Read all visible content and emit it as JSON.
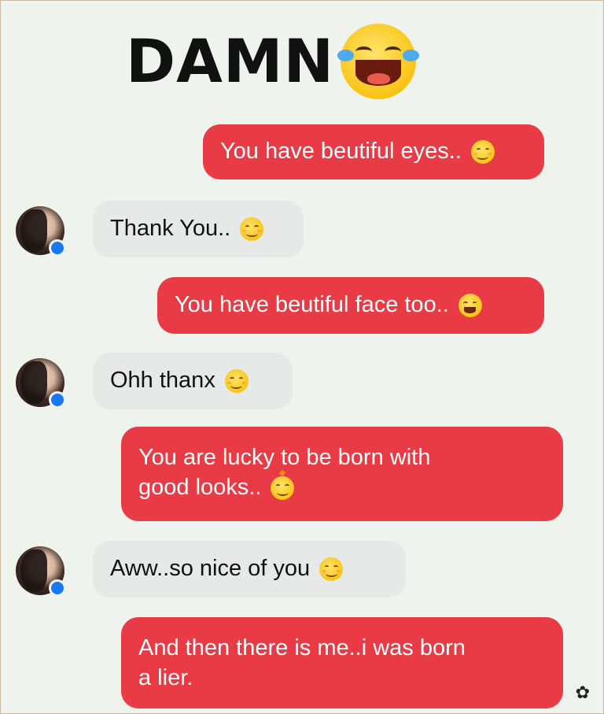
{
  "title": "DAMN",
  "colors": {
    "sent_bubble": "#e83b45",
    "received_bubble": "#e7e9e8",
    "background": "#eef3ee",
    "badge": "#1877f2"
  },
  "messages": [
    {
      "side": "sent",
      "text": "You have beutiful eyes..",
      "emoji": "smiling-face-icon"
    },
    {
      "side": "received",
      "text": "Thank You..",
      "emoji": "smiling-face-icon"
    },
    {
      "side": "sent",
      "text": "You have beutiful face too..",
      "emoji": "grinning-face-icon"
    },
    {
      "side": "received",
      "text": "Ohh thanx",
      "emoji": "smiling-face-icon"
    },
    {
      "side": "sent",
      "text_line1": "You are lucky to be born with",
      "text_line2": "good looks..",
      "emoji": "star-face-icon"
    },
    {
      "side": "received",
      "text": "Aww..so nice of you",
      "emoji": "smiling-face-icon"
    },
    {
      "side": "sent",
      "text_line1": "And then there is me..i was born",
      "text_line2": "a lier."
    }
  ]
}
